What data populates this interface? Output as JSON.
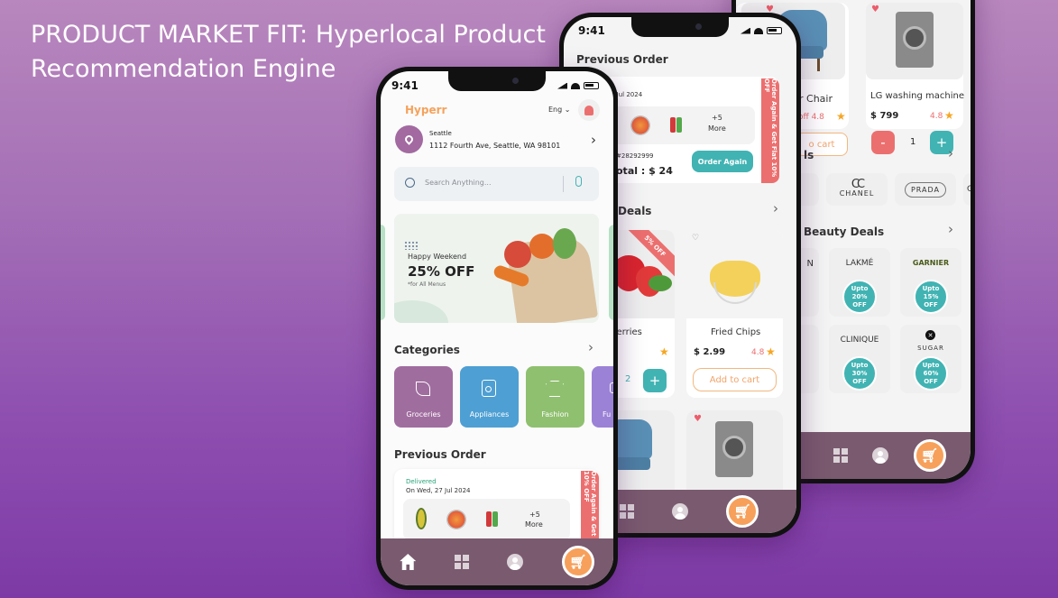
{
  "headline": {
    "line1": "PRODUCT MARKET FIT: Hyperlocal Product",
    "line2": "Recommendation Engine"
  },
  "colors": {
    "accent_orange": "#f7a05b",
    "teal": "#41b3b3",
    "nav_bar": "#7a5a6f",
    "promo_red": "#ec6f6f"
  },
  "front": {
    "time": "9:41",
    "brand": "Hyperr",
    "lang": "Eng",
    "location": {
      "city": "Seattle",
      "address": "1112 Fourth Ave, Seattle, WA 98101"
    },
    "search_placeholder": "Search Anything...",
    "banner": {
      "kicker": "Happy Weekend",
      "offer": "25% OFF",
      "note": "*for All Menus"
    },
    "categories_title": "Categories",
    "categories": [
      {
        "label": "Groceries",
        "color": "#a06d9f",
        "icon": "leaf-icon"
      },
      {
        "label": "Appliances",
        "color": "#4e9fd3",
        "icon": "washer-icon"
      },
      {
        "label": "Fashion",
        "color": "#8fc06f",
        "icon": "shirt-icon"
      },
      {
        "label": "Fu",
        "color": "#9b82d6",
        "icon": "sofa-icon"
      }
    ],
    "previous_order_title": "Previous Order",
    "order": {
      "status": "Delivered",
      "date": "On Wed, 27 Jul 2024",
      "more": "+5",
      "more_label": "More",
      "stamp": "Order Again & Get Flat 10% OFF"
    }
  },
  "middle": {
    "time": "9:41",
    "title": "Previous Order",
    "order": {
      "date": "7 Jul 2024",
      "more": "+5",
      "more_label": "More",
      "id": "#28292999",
      "total": "otal : $ 24",
      "again": "Order Again",
      "stamp": "Order Again & Get Flat 10% OFF"
    },
    "deals_title": "Deals",
    "products": [
      {
        "name": "wberries",
        "qty": "2",
        "badge": "5% OFF"
      },
      {
        "name": "Fried Chips",
        "price": "$ 2.99",
        "rating": "4.8",
        "add": "Add to cart"
      }
    ]
  },
  "back": {
    "products": [
      {
        "name": "r Chair",
        "rating": "off 4.8",
        "add": "o cart"
      },
      {
        "name": "LG washing machine",
        "price": "$ 799",
        "rating": "4.8",
        "minus": "-",
        "qty": "1",
        "plus": "+"
      }
    ],
    "brands_title": "ls",
    "brands": [
      "CHANEL",
      "PRADA",
      "GI"
    ],
    "beauty_title": "Beauty Deals",
    "beauty": [
      {
        "brand": "N",
        "offer": ""
      },
      {
        "brand": "LAKMÉ",
        "offer": "Upto 20% OFF"
      },
      {
        "brand": "GARNIER",
        "offer": "Upto 15% OFF"
      },
      {
        "brand": "CLINIQUE",
        "offer": "Upto 30% OFF"
      },
      {
        "brand": "SUGAR",
        "offer": "Upto 60% OFF"
      }
    ]
  }
}
